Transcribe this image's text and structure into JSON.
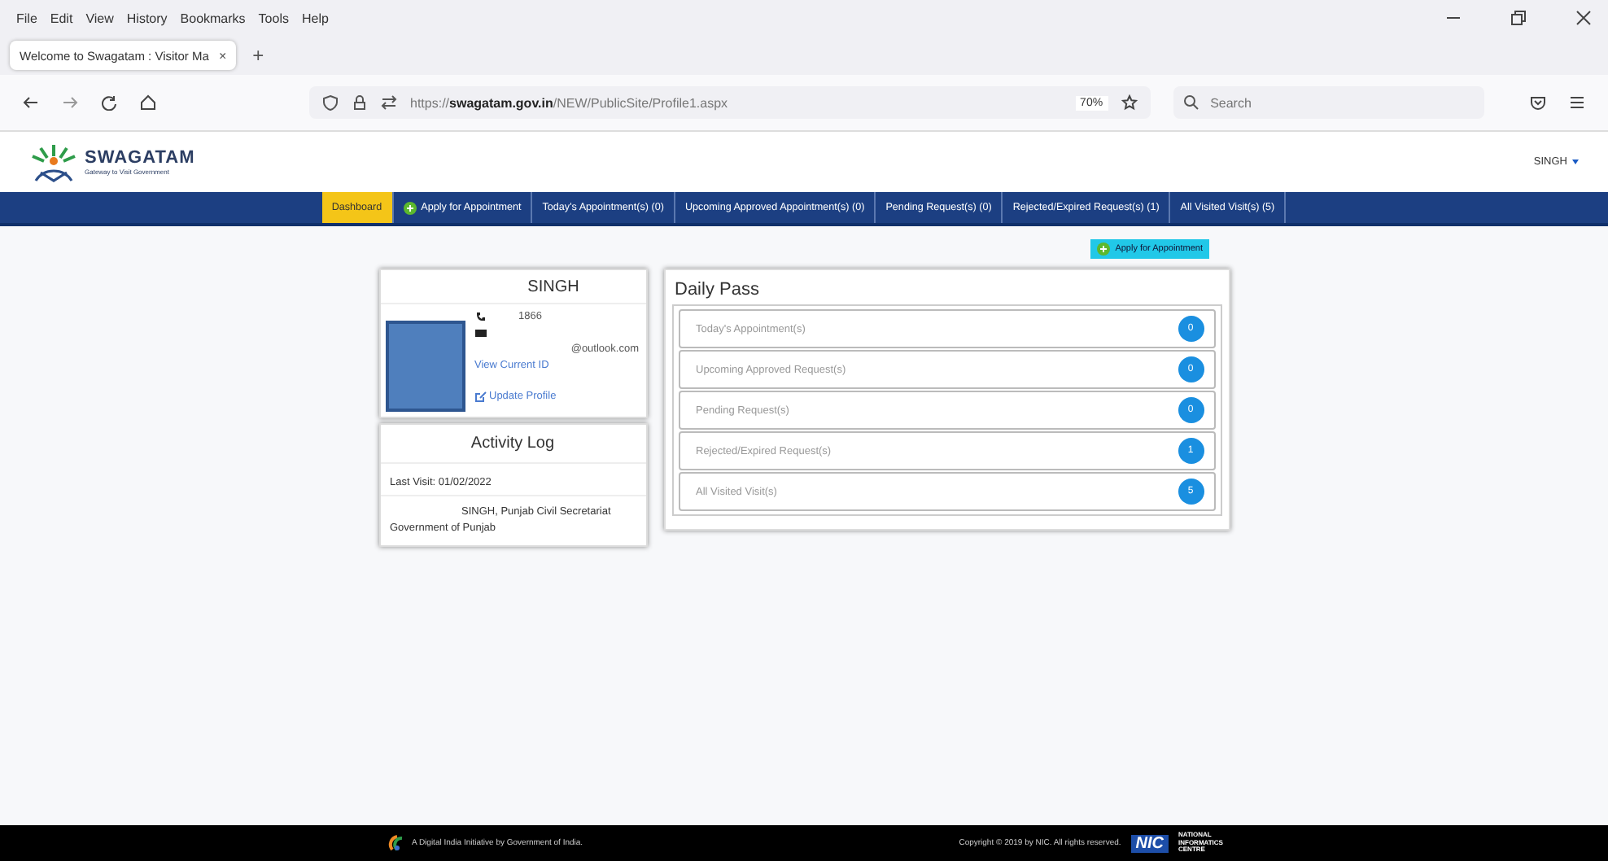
{
  "browser": {
    "menu": [
      "File",
      "Edit",
      "View",
      "History",
      "Bookmarks",
      "Tools",
      "Help"
    ],
    "tab": {
      "title": "Welcome to Swagatam : Visitor Ma",
      "close": "×"
    },
    "new_tab": "+",
    "url": "https://**swagatam.gov.in**/NEW/PublicSite/Profile1.aspx",
    "zoom": "70%",
    "search": {
      "placeholder": "Search"
    }
  },
  "header": {
    "logo_title": "SWAGATAM",
    "logo_tagline": "Gateway to Visit Government",
    "user": "SINGH"
  },
  "nav": [
    {
      "label": "Dashboard",
      "selected": true,
      "kind": "plain"
    },
    {
      "label": "Apply for Appointment",
      "selected": false,
      "kind": "add"
    },
    {
      "label": "Today's Appointment(s) (0)",
      "selected": false,
      "kind": "plain"
    },
    {
      "label": "Upcoming Approved Appointment(s) (0)",
      "selected": false,
      "kind": "plain"
    },
    {
      "label": "Pending Request(s) (0)",
      "selected": false,
      "kind": "plain"
    },
    {
      "label": "Rejected/Expired Request(s) (1)",
      "selected": false,
      "kind": "plain"
    },
    {
      "label": "All Visited Visit(s) (5)",
      "selected": false,
      "kind": "plain"
    }
  ],
  "apply_button": "Apply for Appointment",
  "profile": {
    "name": "SINGH",
    "phone": "1866",
    "email": "@outlook.com",
    "view_id": "View Current ID",
    "update": "Update Profile"
  },
  "activity_log": {
    "title": "Activity Log",
    "last_visit": "Last Visit: 01/02/2022",
    "detail": "SINGH, Punjab Civil Secretariat Government of Punjab"
  },
  "daily_pass": {
    "title": "Daily Pass",
    "items": [
      {
        "label": "Today's Appointment(s)",
        "count": "0"
      },
      {
        "label": "Upcoming Approved Request(s)",
        "count": "0"
      },
      {
        "label": "Pending Request(s)",
        "count": "0"
      },
      {
        "label": "Rejected/Expired Request(s)",
        "count": "1"
      },
      {
        "label": "All Visited Visit(s)",
        "count": "5"
      }
    ]
  },
  "footer": {
    "left": "A Digital India Initiative by Government of India.",
    "right": "Copyright © 2019 by NIC. All rights reserved.",
    "nic": "NIC",
    "nic_name": "NATIONAL INFORMATICS CENTRE"
  }
}
